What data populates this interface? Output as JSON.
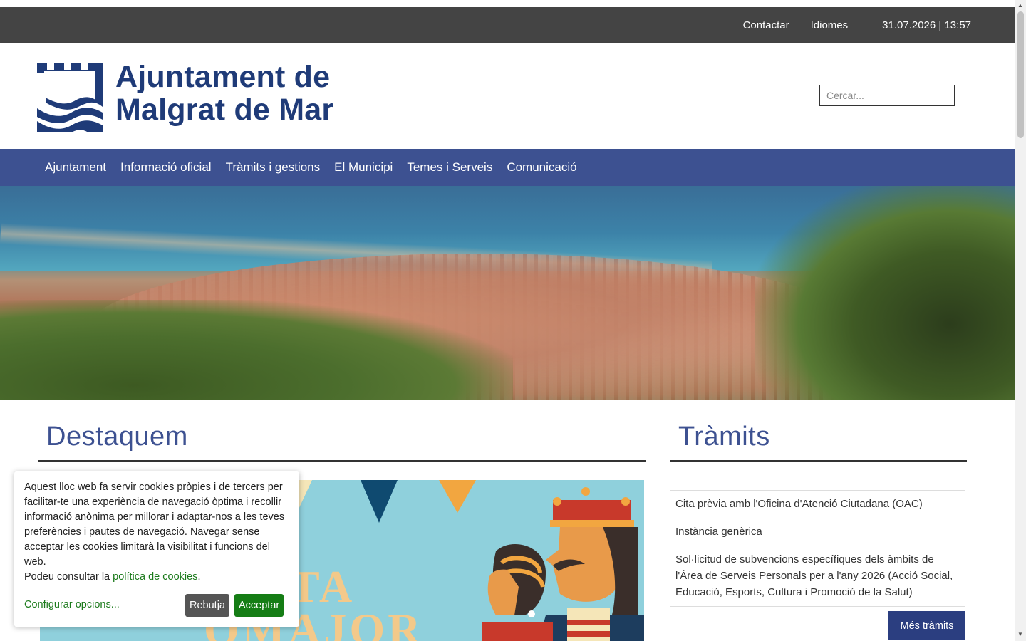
{
  "topbar": {
    "contact": "Contactar",
    "languages": "Idiomes",
    "datetime": "31.07.2026 | 13:57"
  },
  "header": {
    "logo_line1": "Ajuntament de",
    "logo_line2": "Malgrat de Mar",
    "search_placeholder": "Cercar..."
  },
  "nav": {
    "items": [
      "Ajuntament",
      "Informació oficial",
      "Tràmits i gestions",
      "El Municipi",
      "Temes i Serveis",
      "Comunicació"
    ]
  },
  "destaquem": {
    "title": "Destaquem",
    "feature_text_line1": "TA",
    "feature_text_line2": "OMAJOR"
  },
  "tramits": {
    "title": "Tràmits",
    "items": [
      "Cita prèvia amb l'Oficina d'Atenció Ciutadana (OAC)",
      "Instància genèrica",
      "Sol·licitud de subvencions específiques dels àmbits de l'Àrea de Serveis Personals per a l'any 2026 (Acció Social, Educació, Esports, Cultura i Promoció de la Salut)"
    ],
    "more_button": "Més tràmits"
  },
  "cookies": {
    "text": "Aquest lloc web fa servir cookies pròpies i de tercers per facilitar-te una experiència de navegació òptima i recollir informació anònima per millorar i adaptar-nos a les teves preferències i pautes de navegació. Navegar sense acceptar les cookies limitarà la visibilitat i funcions del web.",
    "policy_prefix": "Podeu consultar la ",
    "policy_link": "política de cookies",
    "policy_suffix": ".",
    "configure": "Configurar opcions...",
    "reject": "Rebutja",
    "accept": "Acceptar"
  },
  "colors": {
    "brand_blue": "#3d5191",
    "logo_blue": "#1f3b78",
    "topbar": "#444444",
    "accept_green": "#157d15"
  }
}
